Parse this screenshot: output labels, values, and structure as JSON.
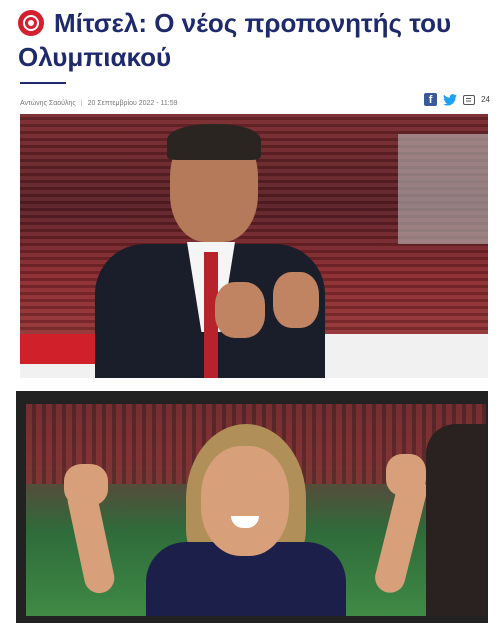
{
  "article": {
    "title_line1": "Μίτσελ: Ο νέος προπονητής του",
    "title_line2": "Ολυμπιακού",
    "author": "Αντώνης Σαούλης",
    "date": "20 Σεπτεμβρίου 2022 - 11:59",
    "comment_count": "24"
  },
  "icons": {
    "logo": "olympiacos-logo-icon",
    "facebook": "facebook-icon",
    "twitter": "twitter-icon",
    "comments": "comment-icon"
  },
  "colors": {
    "headline": "#1e2a6b",
    "brand_red": "#d3202f",
    "facebook": "#3b5998",
    "twitter": "#1da1f2"
  }
}
